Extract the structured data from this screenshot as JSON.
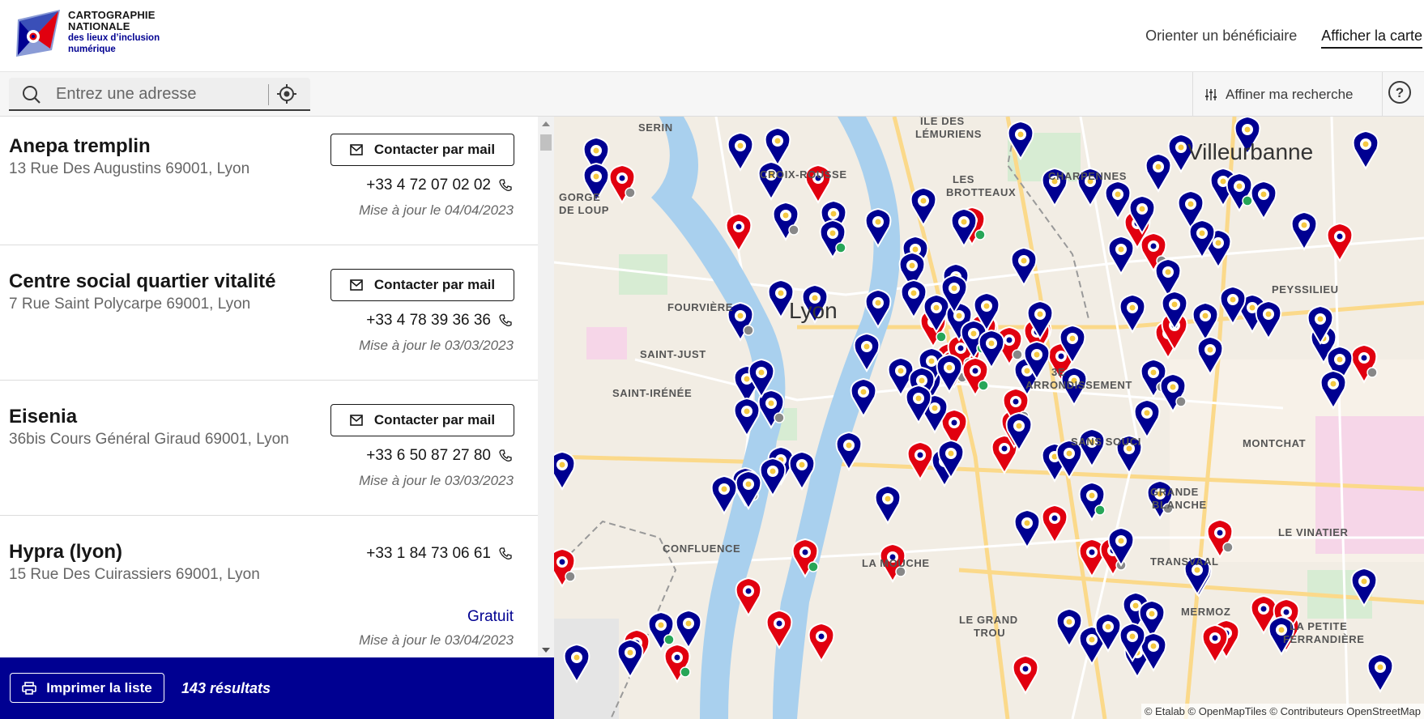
{
  "header": {
    "brand_line1": "CARTOGRAPHIE",
    "brand_line2": "NATIONALE",
    "brand_line3": "des lieux d’inclusion",
    "brand_line4": "numérique",
    "nav": [
      {
        "label": "Orienter un bénéficiaire"
      },
      {
        "label": "Afficher la carte"
      }
    ]
  },
  "search": {
    "placeholder": "Entrez une adresse"
  },
  "filter": {
    "label": "Affiner ma recherche"
  },
  "list": {
    "contact_label": "Contacter par mail",
    "items": [
      {
        "name": "Anepa tremplin",
        "address": "13 Rue Des Augustins 69001, Lyon",
        "phone": "+33 4 72 07 02 02",
        "updated": "Mise à jour le 04/04/2023"
      },
      {
        "name": "Centre social quartier vitalité",
        "address": "7 Rue Saint Polycarpe 69001, Lyon",
        "phone": "+33 4 78 39 36 36",
        "updated": "Mise à jour le 03/03/2023"
      },
      {
        "name": "Eisenia",
        "address": "36bis Cours Général Giraud 69001, Lyon",
        "phone": "+33 6 50 87 27 80",
        "updated": "Mise à jour le 03/03/2023"
      },
      {
        "name": "Hypra (lyon)",
        "address": "15 Rue Des Cuirassiers 69001, Lyon",
        "phone": "+33 1 84 73 06 61",
        "tag": "Gratuit",
        "updated": "Mise à jour le 03/04/2023"
      }
    ]
  },
  "bottom": {
    "print_label": "Imprimer la liste",
    "results": "143 résultats"
  },
  "map": {
    "city": "Lyon",
    "city2": "Villeurbanne",
    "labels": [
      "SERIN",
      "ÎLE DES",
      "LÉMURIENS",
      "CHARPENNES",
      "LES",
      "BROTTEAUX",
      "FOURVIÈRE",
      "SAINT-JUST",
      "SAINT-IRÉNÉE",
      "CONFLUENCE",
      "LA MOUCHE",
      "SANS SOUCI",
      "MONTCHAT",
      "GRANDE",
      "BLANCHE",
      "LE VINATIER",
      "LA PETITE",
      "FERRANDIÈRE",
      "LE GRAND",
      "TROU",
      "3E",
      "ARRONDISSEMENT",
      "GORGE",
      "DE LOUP",
      "CROIX-ROUSSE",
      "PEYSSILIEU",
      "TRANSVAAL",
      "MERMOZ"
    ],
    "attribution": "© Etalab © OpenMapTiles © Contributeurs OpenStreetMap",
    "colors": {
      "blue_pin": "#000091",
      "red_pin": "#e1000f",
      "green_dot": "#27a658",
      "grey_dot": "#888888"
    }
  }
}
